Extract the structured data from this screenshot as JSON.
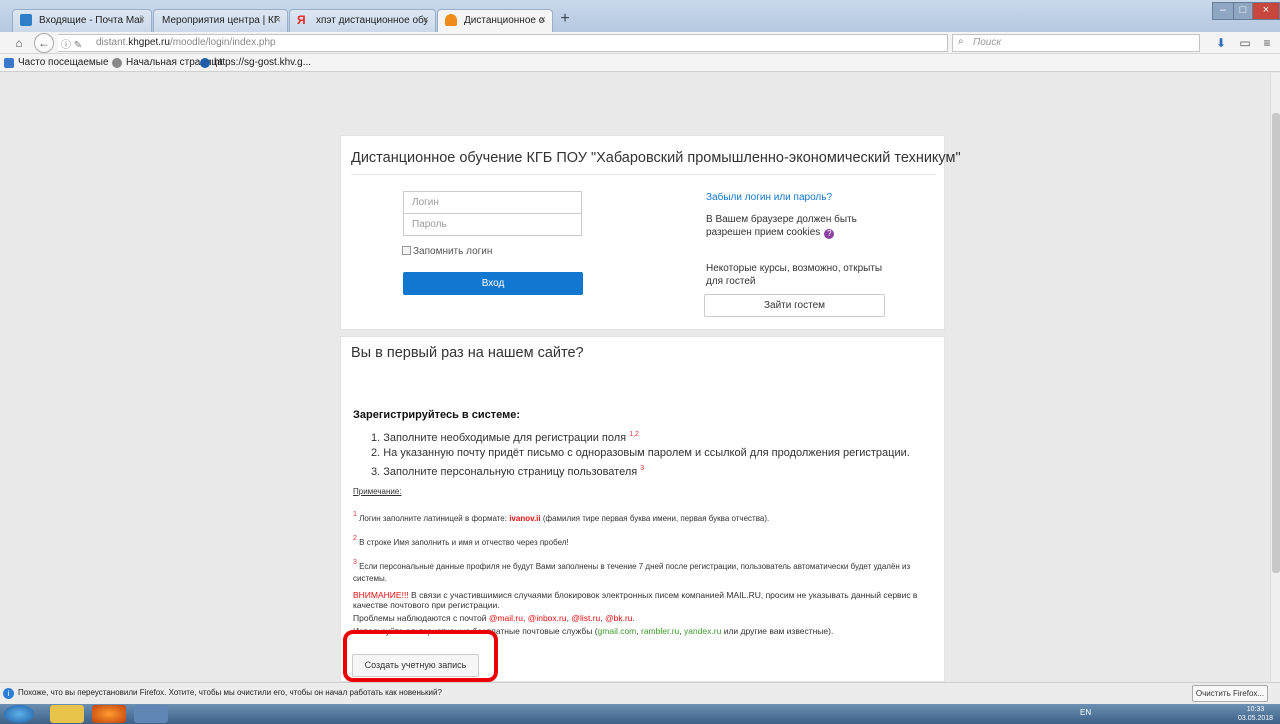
{
  "browser": {
    "tabs": [
      {
        "label": "Входящие - Почта Mail.Ru",
        "icon": "mail-icon",
        "color": "#2f7fc8",
        "active": false
      },
      {
        "label": "Мероприятия центра | КГБ П...",
        "icon": "page-icon",
        "color": "#cccccc",
        "active": false
      },
      {
        "label": "хпэт дистанционное обуч...",
        "icon": "yandex-icon",
        "color": "#e32b2b",
        "active": false
      },
      {
        "label": "Дистанционное обучение...",
        "icon": "moodle-icon",
        "color": "#f08c1a",
        "active": true
      }
    ],
    "new_tab": "+",
    "url_prefix": "distant.",
    "url_domain": "khgpet.ru",
    "url_path": "/moodle/login/index.php",
    "search_placeholder": "Поиск",
    "bookmarks": [
      {
        "label": "Часто посещаемые",
        "color": "#3a78c9"
      },
      {
        "label": "Начальная страница",
        "color": "#888888"
      },
      {
        "label": "https://sg-gost.khv.g...",
        "color": "#1e5fa8"
      }
    ]
  },
  "login": {
    "title": "Дистанционное обучение КГБ ПОУ \"Хабаровский промышленно-экономический техникум\"",
    "username_placeholder": "Логин",
    "password_placeholder": "Пароль",
    "remember_label": "Запомнить логин",
    "login_button": "Вход",
    "forgot_link": "Забыли логин или пароль?",
    "cookies_text": "В Вашем браузере должен быть разрешен прием cookies",
    "guest_text": "Некоторые курсы, возможно, открыты для гостей",
    "guest_button": "Зайти гостем"
  },
  "registration": {
    "heading": "Вы в первый раз на нашем сайте?",
    "subheading": "Зарегистрируйтесь в системе:",
    "steps": [
      {
        "text": "1. Заполните необходимые для регистрации поля",
        "sup": "1,2"
      },
      {
        "text": "2. На указанную почту придёт письмо с одноразовым паролем и ссылкой для продолжения регистрации.",
        "sup": ""
      },
      {
        "text": "3. Заполните персональную страницу пользователя",
        "sup": "3"
      }
    ],
    "note_title": "Примечание:",
    "note1_sup": "1",
    "note1_pre": "Логин заполните латиницей в формате:",
    "note1_example": "ivanov.ii",
    "note1_post": "(фамилия тире первая буква имени, первая буква отчества).",
    "note2_sup": "2",
    "note2": "В строке Имя заполнить и имя и отчество через пробел!",
    "note3_sup": "3",
    "note3": "Если персональные данные профиля не будут Вами заполнены в течение 7 дней после регистрации, пользователь автоматически будет удалён из системы.",
    "warning_label": "ВНИМАНИЕ!!!",
    "warning_text": "В связи с участившимися случаями блокировок электронных писем компанией MAIL.RU, просим не указывать данный сервис в качестве почтового при регистрации.",
    "problems_text": "Проблемы наблюдаются с почтой",
    "bad_domains": [
      "@mail.ru",
      "@inbox.ru",
      "@list.ru",
      "@bk.ru"
    ],
    "alt_text": "Используйте альтернативные бесплатные почтовые службы",
    "good_domains": [
      "gmail.com",
      "rambler.ru",
      "yandex.ru"
    ],
    "alt_tail": "или другие вам известные).",
    "create_button": "Создать учетную запись"
  },
  "notification": {
    "text": "Похоже, что вы переустановили Firefox. Хотите, чтобы мы очистили его, чтобы он начал работать как новенький?",
    "button": "Очистить Firefox..."
  },
  "taskbar": {
    "lang": "EN",
    "time": "10:33",
    "date": "03.05.2018"
  }
}
